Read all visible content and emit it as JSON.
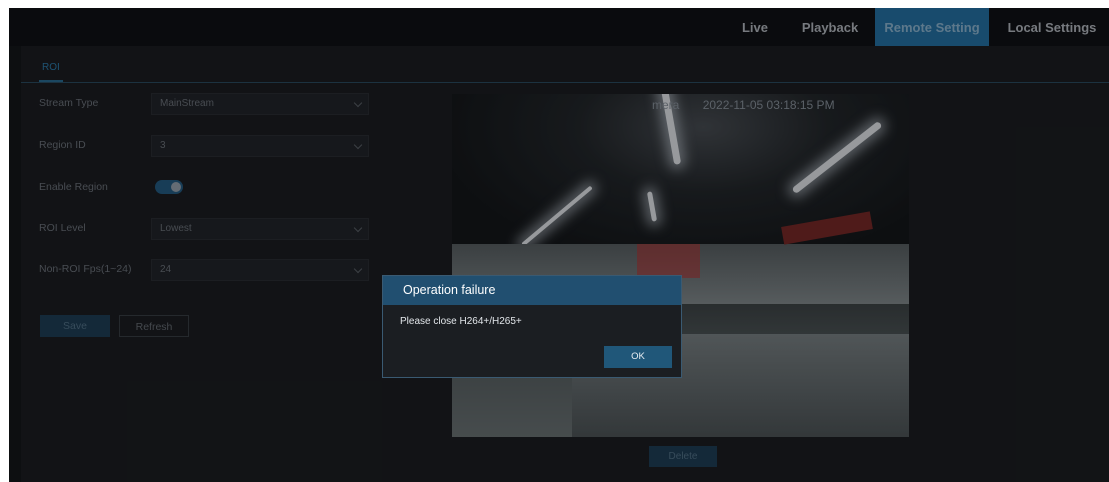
{
  "nav": {
    "items": [
      {
        "label": "Live",
        "active": false
      },
      {
        "label": "Playback",
        "active": false
      },
      {
        "label": "Remote Setting",
        "active": true
      },
      {
        "label": "Local Settings",
        "active": false
      }
    ]
  },
  "tabs": [
    {
      "label": "ROI",
      "active": true
    }
  ],
  "form": {
    "stream_type": {
      "label": "Stream Type",
      "value": "MainStream"
    },
    "region_id": {
      "label": "Region ID",
      "value": "3"
    },
    "enable_region": {
      "label": "Enable Region",
      "enabled": true
    },
    "roi_level": {
      "label": "ROI Level",
      "value": "Lowest"
    },
    "non_roi_fps": {
      "label": "Non-ROI Fps(1~24)",
      "value": "24"
    }
  },
  "buttons": {
    "save": "Save",
    "refresh": "Refresh",
    "delete": "Delete"
  },
  "preview": {
    "osd_name": "mera",
    "osd_time": "2022-11-05 03:18:15 PM"
  },
  "dialog": {
    "title": "Operation failure",
    "message": "Please close H264+/H265+",
    "ok": "OK"
  },
  "colors": {
    "accent": "#2574a8",
    "dialog_header": "#214f70",
    "roi_region": "#be3232"
  }
}
